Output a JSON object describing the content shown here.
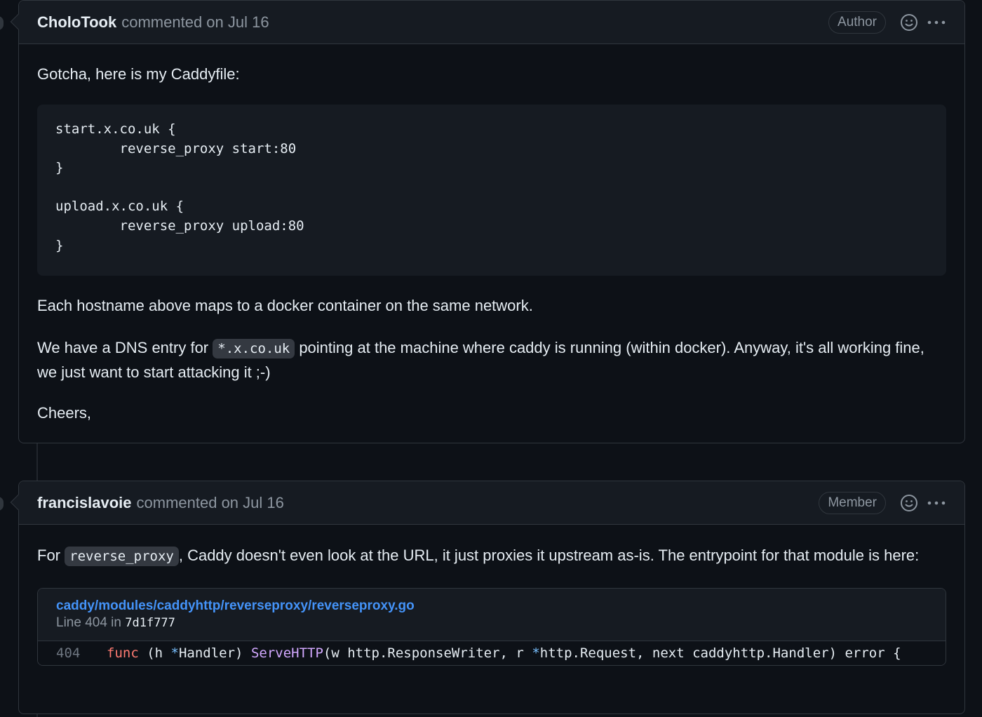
{
  "comments": [
    {
      "author": "CholoTook",
      "meta": "commented on Jul 16",
      "role": "Author",
      "intro": "Gotcha, here is my Caddyfile:",
      "code": "start.x.co.uk {\n        reverse_proxy start:80\n}\n\nupload.x.co.uk {\n        reverse_proxy upload:80\n}",
      "p2": "Each hostname above maps to a docker container on the same network.",
      "p3_before": "We have a DNS entry for ",
      "p3_code": "*.x.co.uk",
      "p3_after": " pointing at the machine where caddy is running (within docker). Anyway, it's all working fine, we just want to start attacking it ;-)",
      "p4": "Cheers,"
    },
    {
      "author": "francislavoie",
      "meta": "commented on Jul 16",
      "role": "Member",
      "p1_before": "For ",
      "p1_code": "reverse_proxy",
      "p1_after": ", Caddy doesn't even look at the URL, it just proxies it upstream as-is. The entrypoint for that module is here:",
      "permalink": {
        "path": "caddy/modules/caddyhttp/reverseproxy/reverseproxy.go",
        "line_prefix": "Line 404 in ",
        "sha": "7d1f777",
        "line_number": "404",
        "code_kw": "func",
        "code_a": " (h ",
        "code_star1": "*",
        "code_b": "Handler) ",
        "code_fn": "ServeHTTP",
        "code_c": "(w http.ResponseWriter, r ",
        "code_star2": "*",
        "code_d": "http.Request, next caddyhttp.Handler) error {"
      }
    }
  ],
  "icons": {
    "reaction": "smiley-icon",
    "menu": "kebab-horizontal-icon"
  },
  "colors": {
    "background": "#0d1117",
    "header": "#161b22",
    "border": "#30363d",
    "link": "#4493f8",
    "keyword": "#ff7b72",
    "function": "#d2a8ff"
  }
}
